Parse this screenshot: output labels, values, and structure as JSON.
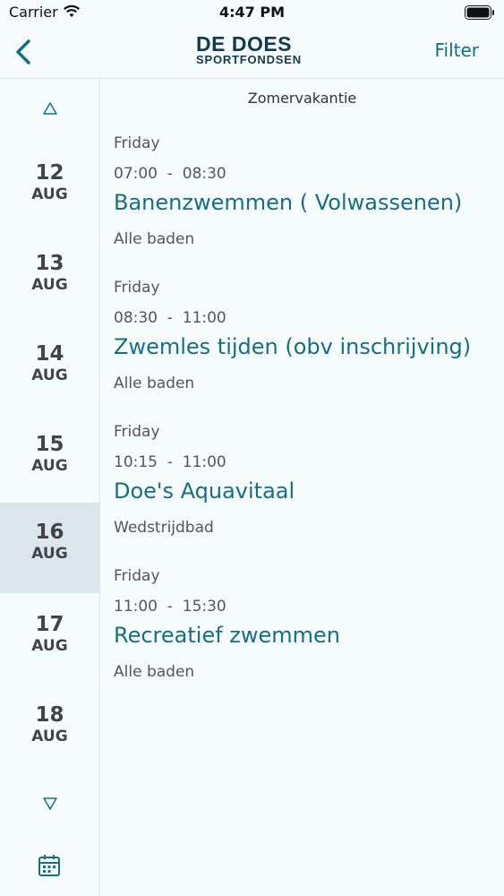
{
  "status_bar": {
    "carrier": "Carrier",
    "time": "4:47 PM"
  },
  "nav": {
    "logo_line1": "DE DOES",
    "logo_line2": "SPORTFONDSEN",
    "filter_label": "Filter"
  },
  "sidebar": {
    "dates": [
      {
        "day": "12",
        "month": "AUG",
        "selected": false
      },
      {
        "day": "13",
        "month": "AUG",
        "selected": false
      },
      {
        "day": "14",
        "month": "AUG",
        "selected": false
      },
      {
        "day": "15",
        "month": "AUG",
        "selected": false
      },
      {
        "day": "16",
        "month": "AUG",
        "selected": true
      },
      {
        "day": "17",
        "month": "AUG",
        "selected": false
      },
      {
        "day": "18",
        "month": "AUG",
        "selected": false
      }
    ]
  },
  "main": {
    "section_title": "Zomervakantie",
    "events": [
      {
        "weekday": "Friday",
        "start": "07:00",
        "end": "08:30",
        "title": "Banenzwemmen ( Volwassenen)",
        "location": "Alle baden"
      },
      {
        "weekday": "Friday",
        "start": "08:30",
        "end": "11:00",
        "title": "Zwemles tijden (obv inschrijving)",
        "location": "Alle baden"
      },
      {
        "weekday": "Friday",
        "start": "10:15",
        "end": "11:00",
        "title": "Doe's Aquavitaal",
        "location": "Wedstrijdbad"
      },
      {
        "weekday": "Friday",
        "start": "11:00",
        "end": "15:30",
        "title": "Recreatief zwemmen",
        "location": "Alle baden"
      }
    ]
  },
  "colors": {
    "accent": "#156f82",
    "selected_bg": "#dce6ef",
    "background": "#f6fbfc"
  }
}
